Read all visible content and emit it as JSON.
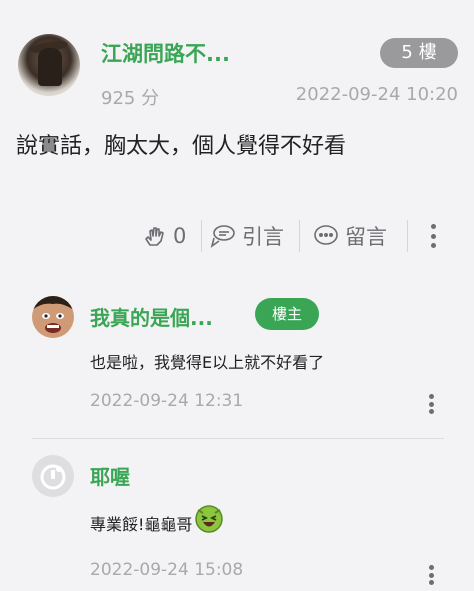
{
  "post": {
    "author": "江湖問路不...",
    "floor": "5 樓",
    "score": "925 分",
    "time": "2022-09-24 10:20",
    "content": "說實話，胸太大，個人覺得不好看",
    "actions": {
      "like_count": "0",
      "quote_label": "引言",
      "comment_label": "留言"
    }
  },
  "replies": [
    {
      "author": "我真的是個...",
      "badge": "樓主",
      "text": "也是啦，我覺得E以上就不好看了",
      "time": "2022-09-24 12:31"
    },
    {
      "author": "耶喔",
      "text": "專業餒!龜龜哥",
      "time": "2022-09-24 15:08"
    }
  ],
  "colors": {
    "accent": "#3aa655",
    "floor_badge": "#9a9a9d",
    "muted": "#a9a9ad"
  }
}
